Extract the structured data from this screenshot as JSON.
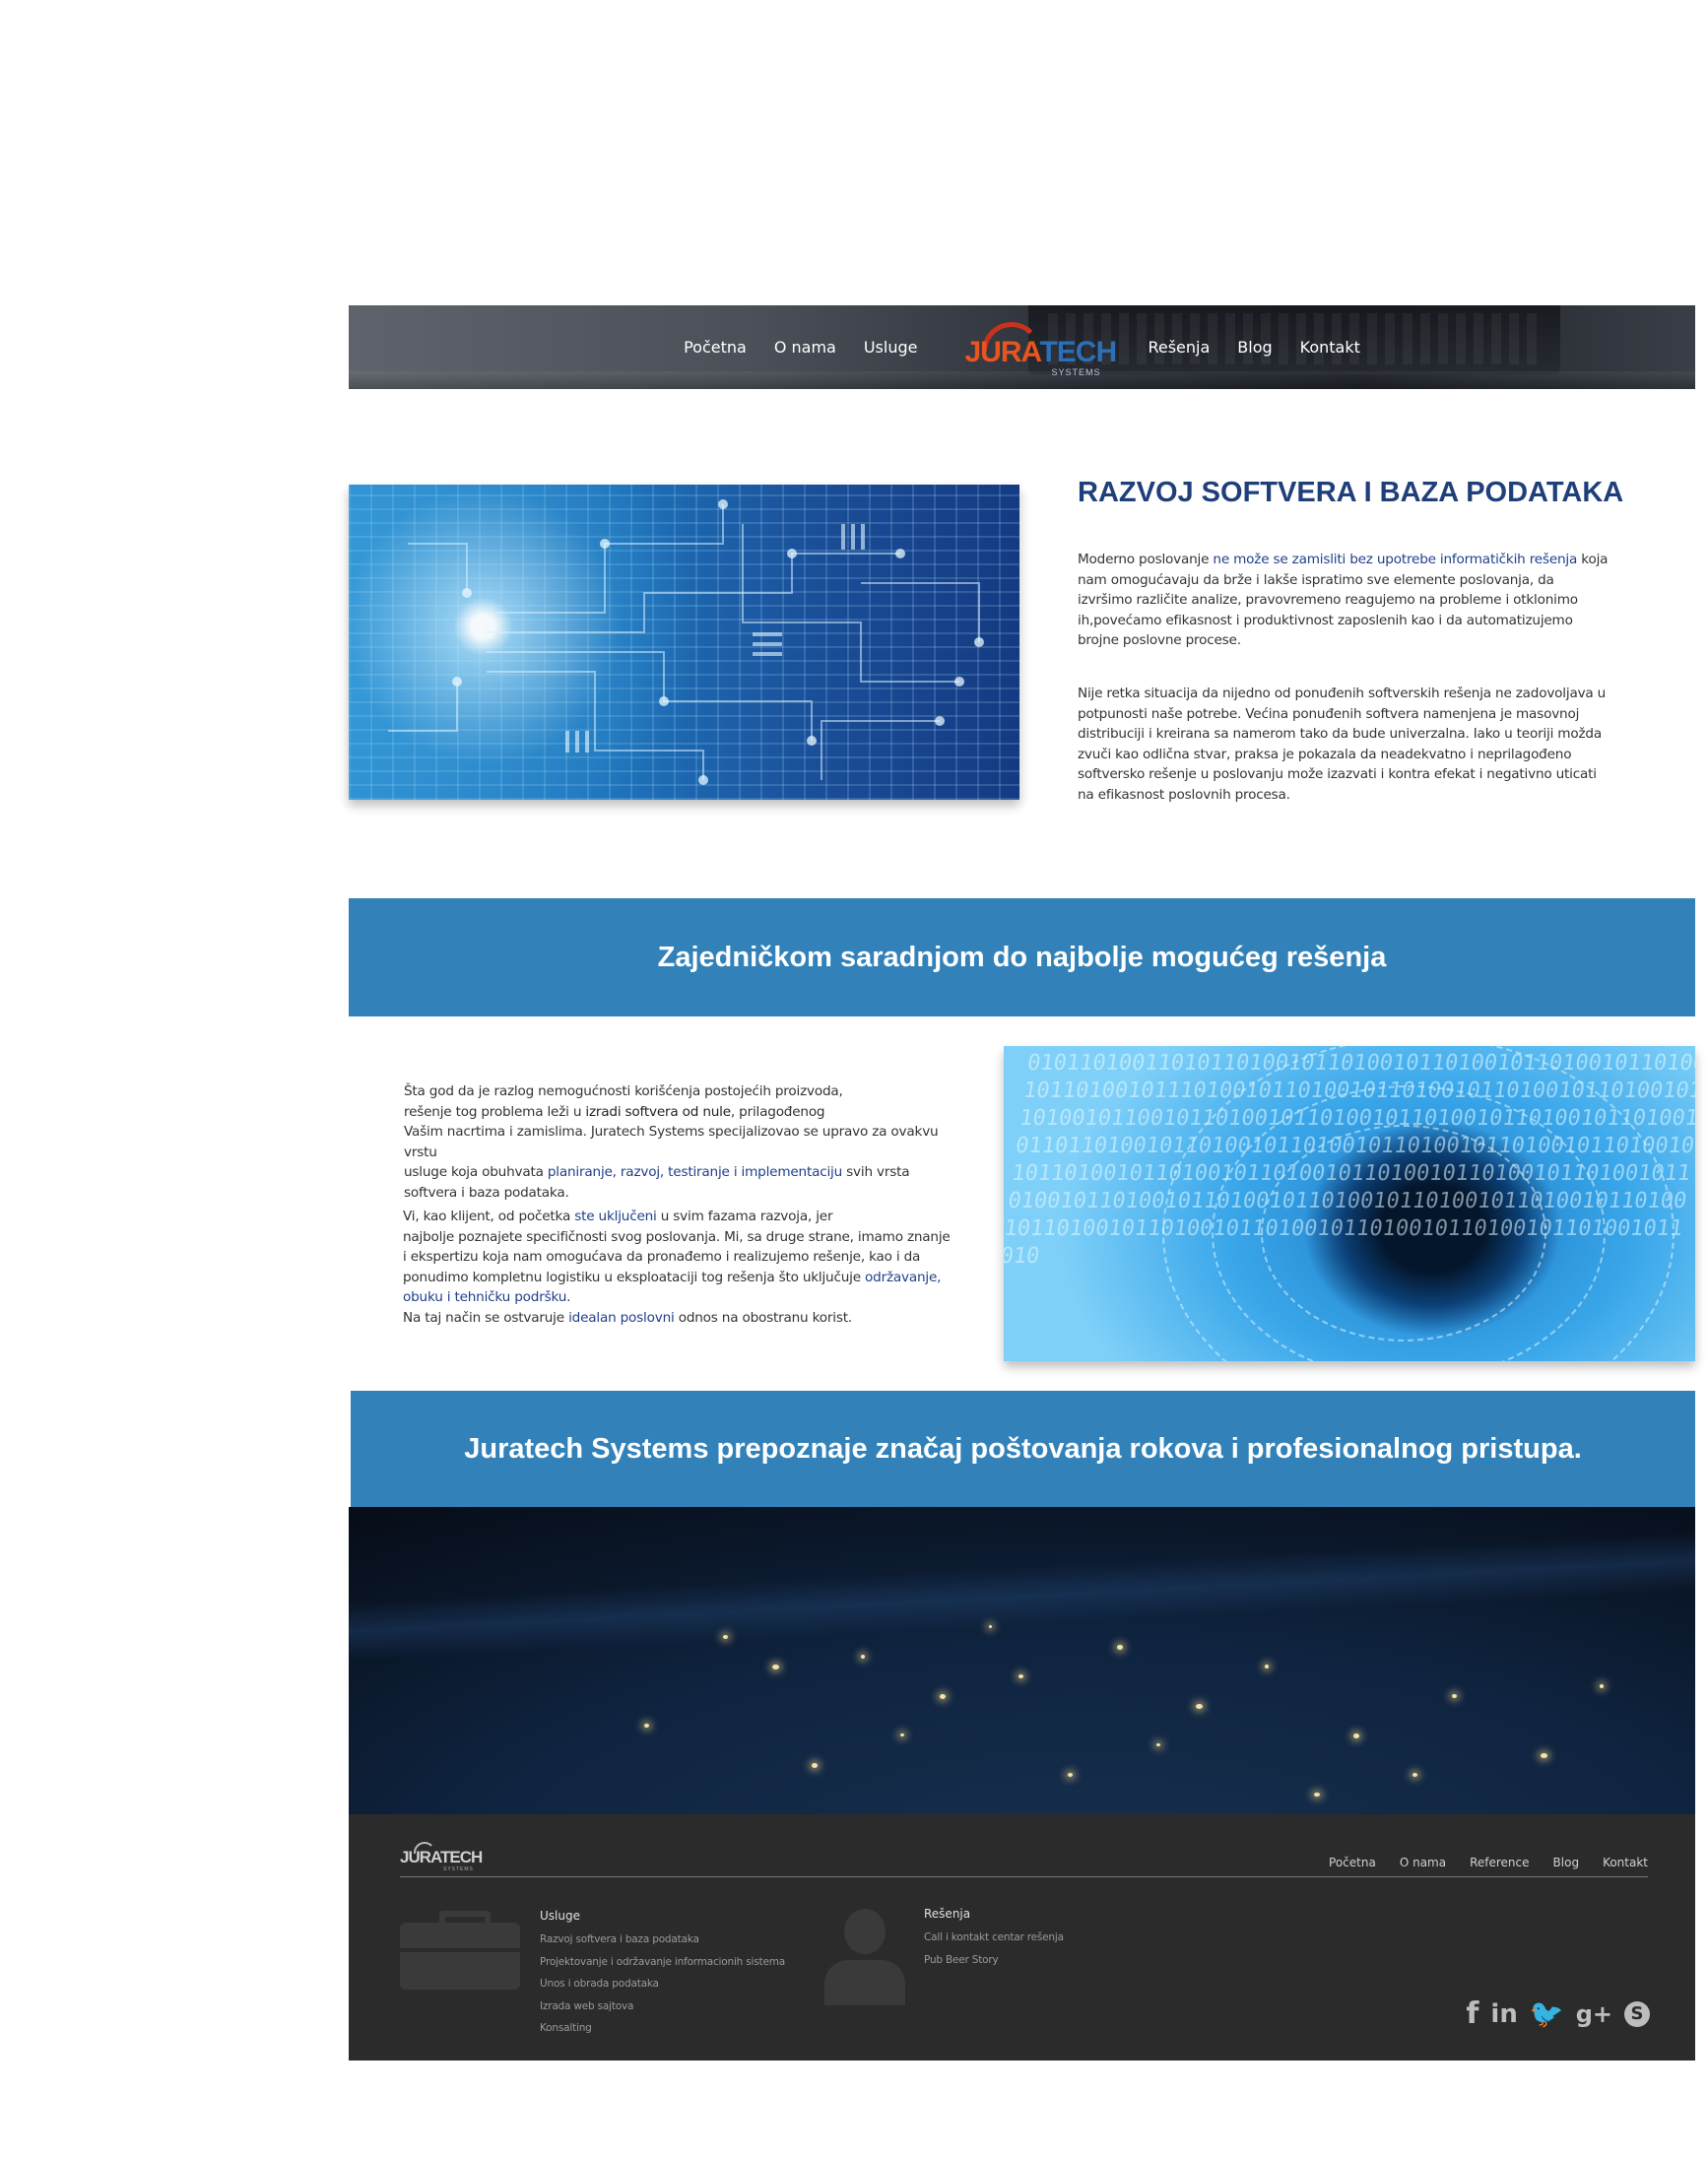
{
  "nav": {
    "items_left": [
      "Početna",
      "O nama",
      "Usluge"
    ],
    "items_right": [
      "Rešenja",
      "Blog",
      "Kontakt"
    ],
    "logo": {
      "part1": "JURA",
      "part2": "TECH",
      "sub": "SYSTEMS"
    }
  },
  "section1": {
    "title": "RAZVOJ SOFTVERA I BAZA PODATAKA",
    "p1": {
      "pre": "Moderno poslovanje ",
      "hl": "ne može se zamisliti bez upotrebe informatičkih rešenja",
      "post": " koja nam omogućavaju da brže i lakše ispratimo sve elemente poslovanja, da izvršimo različite analize, pravovremeno reagujemo na probleme i otklonimo ih,povećamo efikasnost i produktivnost zaposlenih kao i da automatizujemo brojne poslovne procese."
    },
    "p2": "Nije retka situacija da nijedno od ponuđenih softverskih rešenja ne zadovoljava u potpunosti naše potrebe. Većina ponuđenih softvera namenjena je masovnoj distribuciji i kreirana sa namerom tako da bude univerzalna. Iako u teoriji možda zvuči kao odlična stvar, praksa je pokazala da neadekvatno i neprilagođeno softversko rešenje u poslovanju može izazvati i kontra efekat i negativno uticati na efikasnost poslovnih procesa."
  },
  "banner1": "Zajedničkom saradnjom do najbolje mogućeg rešenja",
  "section2": {
    "p1": {
      "a": "Šta god da je razlog nemogućnosti korišćenja postojećih proizvoda,",
      "b": "rešenje tog problema leži u ",
      "b_hl": "izradi softvera od nule",
      "c": ", prilagođenog",
      "d": "Vašim nacrtima i zamislima. Juratech Systems specijalizovao se upravo za ovakvu vrstu",
      "e": "usluge koja obuhvata ",
      "e_hl": "planiranje, razvoj, testiranje i implementaciju",
      "f": " svih vrsta",
      "g": "softvera i baza podataka."
    },
    "p2": {
      "a": "Vi, kao klijent, od početka ",
      "a_hl": "ste uključeni",
      "b": " u svim fazama razvoja, jer",
      "c": "najbolje poznajete specifičnosti svog poslovanja. Mi, sa druge strane, imamo znanje",
      "d": "i ekspertizu koja nam omogućava da pronađemo i realizujemo rešenje, kao i da",
      "e": "ponudimo kompletnu logistiku u eksploataciji tog rešenja što uključuje ",
      "e_hl": "održavanje,",
      "f_hl": "obuku i tehničku podršku",
      "f": ".",
      "g": "Na taj način se ostvaruje ",
      "g_hl": "idealan poslovni",
      "h": " odnos na obostranu korist."
    }
  },
  "banner2": "Juratech Systems prepoznaje značaj poštovanja rokova i profesionalnog pristupa.",
  "footer": {
    "logo": {
      "text": "JURATECH",
      "sub": "SYSTEMS"
    },
    "nav": [
      "Početna",
      "O nama",
      "Reference",
      "Blog",
      "Kontakt"
    ],
    "usluge": {
      "title": "Usluge",
      "items": [
        "Razvoj softvera i baza podataka",
        "Projektovanje i održavanje informacionih sistema",
        "Unos i obrada podataka",
        "Izrada web sajtova",
        "Konsalting"
      ]
    },
    "resenja": {
      "title": "Rešenja",
      "items": [
        "Call i kontakt centar rešenja",
        "Pub Beer Story"
      ]
    },
    "socials": [
      "f",
      "in",
      "🐦",
      "g+",
      "S"
    ]
  },
  "colors": {
    "banner": "#3282b9",
    "title": "#1f3f7a",
    "footer": "#2b2b2b",
    "highlight": "#1f3f8a"
  }
}
